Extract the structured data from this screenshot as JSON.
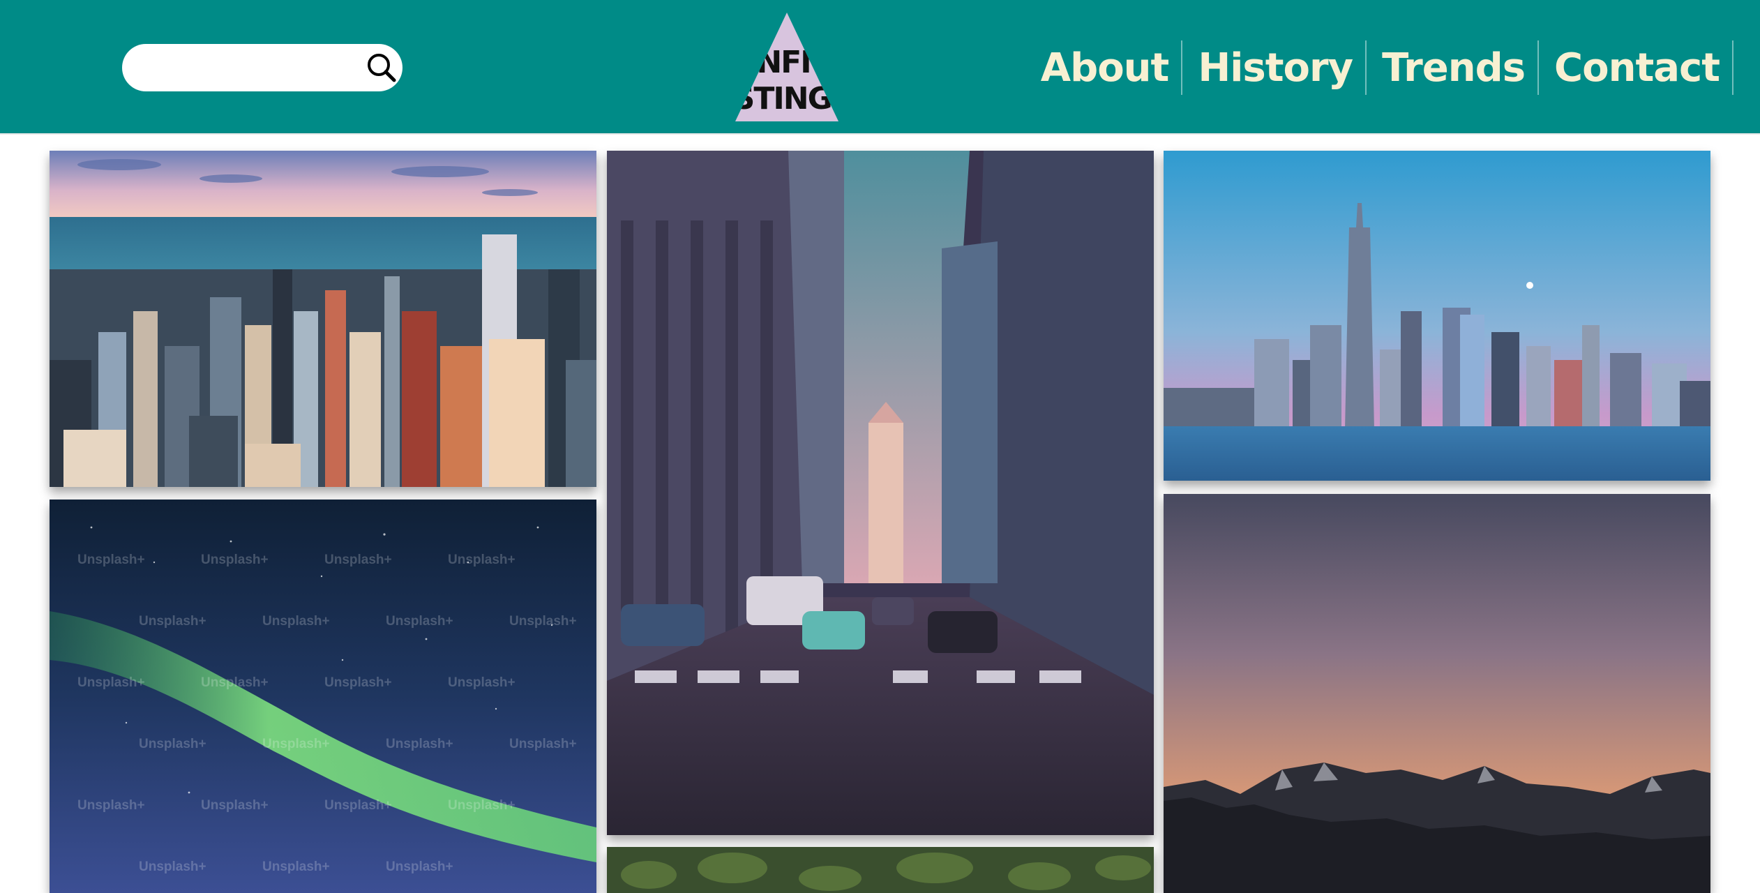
{
  "header": {
    "background": "#008b87",
    "search": {
      "placeholder": "",
      "value": "",
      "icon": "search-icon"
    },
    "logo": {
      "line1": "NFI",
      "line2": "ISTING",
      "color": "#d8c4de"
    },
    "nav": [
      {
        "label": "About"
      },
      {
        "label": "History"
      },
      {
        "label": "Trends"
      },
      {
        "label": "Contact"
      }
    ]
  },
  "gallery": {
    "tiles": [
      {
        "name": "chicago-aerial-skyline"
      },
      {
        "name": "city-street-canyon"
      },
      {
        "name": "manhattan-skyline-dusk"
      },
      {
        "name": "aurora-night-sky",
        "watermark": "Unsplash+"
      },
      {
        "name": "mountain-sunset"
      },
      {
        "name": "forest-treetops"
      }
    ]
  }
}
